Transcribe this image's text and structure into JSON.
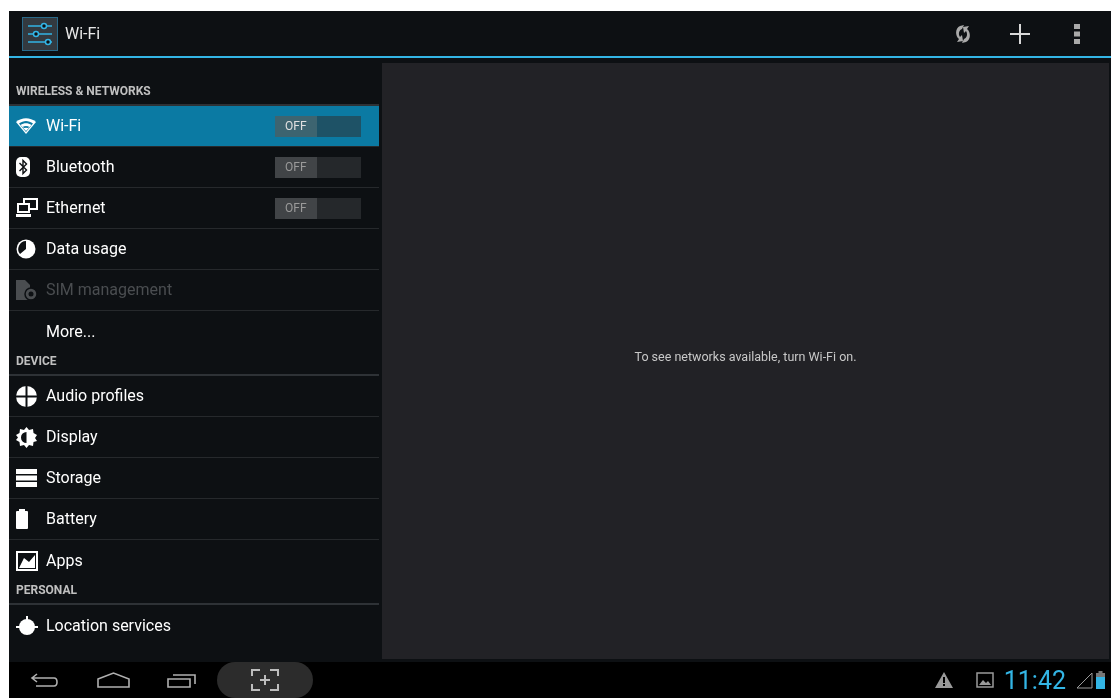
{
  "action_bar": {
    "title": "Wi-Fi"
  },
  "sections": [
    {
      "header": "WIRELESS & NETWORKS",
      "items": [
        {
          "label": "Wi-Fi",
          "kind": "toggle",
          "selected": true,
          "disabled": false,
          "switch": {
            "label": "OFF",
            "on": false
          }
        },
        {
          "label": "Bluetooth",
          "kind": "toggle",
          "selected": false,
          "disabled": false,
          "switch": {
            "label": "OFF",
            "on": false
          }
        },
        {
          "label": "Ethernet",
          "kind": "toggle",
          "selected": false,
          "disabled": false,
          "switch": {
            "label": "OFF",
            "on": false
          }
        },
        {
          "label": "Data usage",
          "kind": "plain",
          "selected": false,
          "disabled": false
        },
        {
          "label": "SIM management",
          "kind": "plain",
          "selected": false,
          "disabled": true
        },
        {
          "label": "More...",
          "kind": "plain",
          "selected": false,
          "disabled": false
        }
      ]
    },
    {
      "header": "DEVICE",
      "items": [
        {
          "label": "Audio profiles",
          "kind": "plain",
          "selected": false,
          "disabled": false
        },
        {
          "label": "Display",
          "kind": "plain",
          "selected": false,
          "disabled": false
        },
        {
          "label": "Storage",
          "kind": "plain",
          "selected": false,
          "disabled": false
        },
        {
          "label": "Battery",
          "kind": "plain",
          "selected": false,
          "disabled": false
        },
        {
          "label": "Apps",
          "kind": "plain",
          "selected": false,
          "disabled": false
        }
      ]
    },
    {
      "header": "PERSONAL",
      "items": [
        {
          "label": "Location services",
          "kind": "plain",
          "selected": false,
          "disabled": false
        }
      ]
    }
  ],
  "detail": {
    "message": "To see networks available, turn Wi-Fi on."
  },
  "status_bar": {
    "time": "11:42"
  }
}
